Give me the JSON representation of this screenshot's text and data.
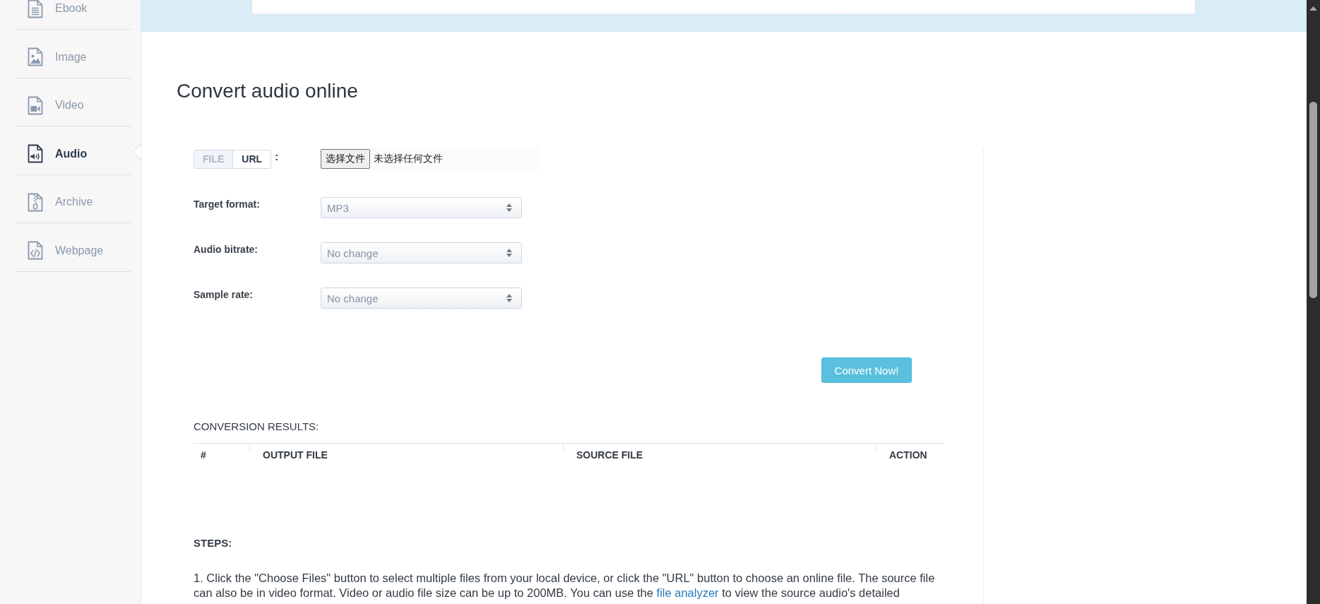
{
  "sidebar": {
    "items": [
      {
        "label": "Ebook",
        "selected": false
      },
      {
        "label": "Image",
        "selected": false
      },
      {
        "label": "Video",
        "selected": false
      },
      {
        "label": "Audio",
        "selected": true
      },
      {
        "label": "Archive",
        "selected": false
      },
      {
        "label": "Webpage",
        "selected": false
      }
    ]
  },
  "page": {
    "title": "Convert audio online"
  },
  "source": {
    "tabs": [
      {
        "label": "FILE",
        "selected": true
      },
      {
        "label": "URL",
        "selected": false
      }
    ],
    "separator": ":",
    "file_button": "选择文件",
    "file_status": "未选择任何文件"
  },
  "options": [
    {
      "label": "Target format:",
      "value": "MP3"
    },
    {
      "label": "Audio bitrate:",
      "value": "No change"
    },
    {
      "label": "Sample rate:",
      "value": "No change"
    }
  ],
  "convert_button": "Convert Now!",
  "results": {
    "title": "CONVERSION RESULTS:",
    "columns": [
      "#",
      "OUTPUT FILE",
      "SOURCE FILE",
      "ACTION"
    ]
  },
  "steps": {
    "title": "STEPS:",
    "paragraph": [
      {
        "kind": "text",
        "text": "1. Click the \"Choose Files\" button to select multiple files from your local device, or click the \"URL\" button to choose an online file. The source file can also be in video format. Video or audio file size can be up to 200MB. You can use the "
      },
      {
        "kind": "link",
        "text": "file analyzer"
      },
      {
        "kind": "text",
        "text": " to view the source audio's detailed"
      }
    ]
  }
}
